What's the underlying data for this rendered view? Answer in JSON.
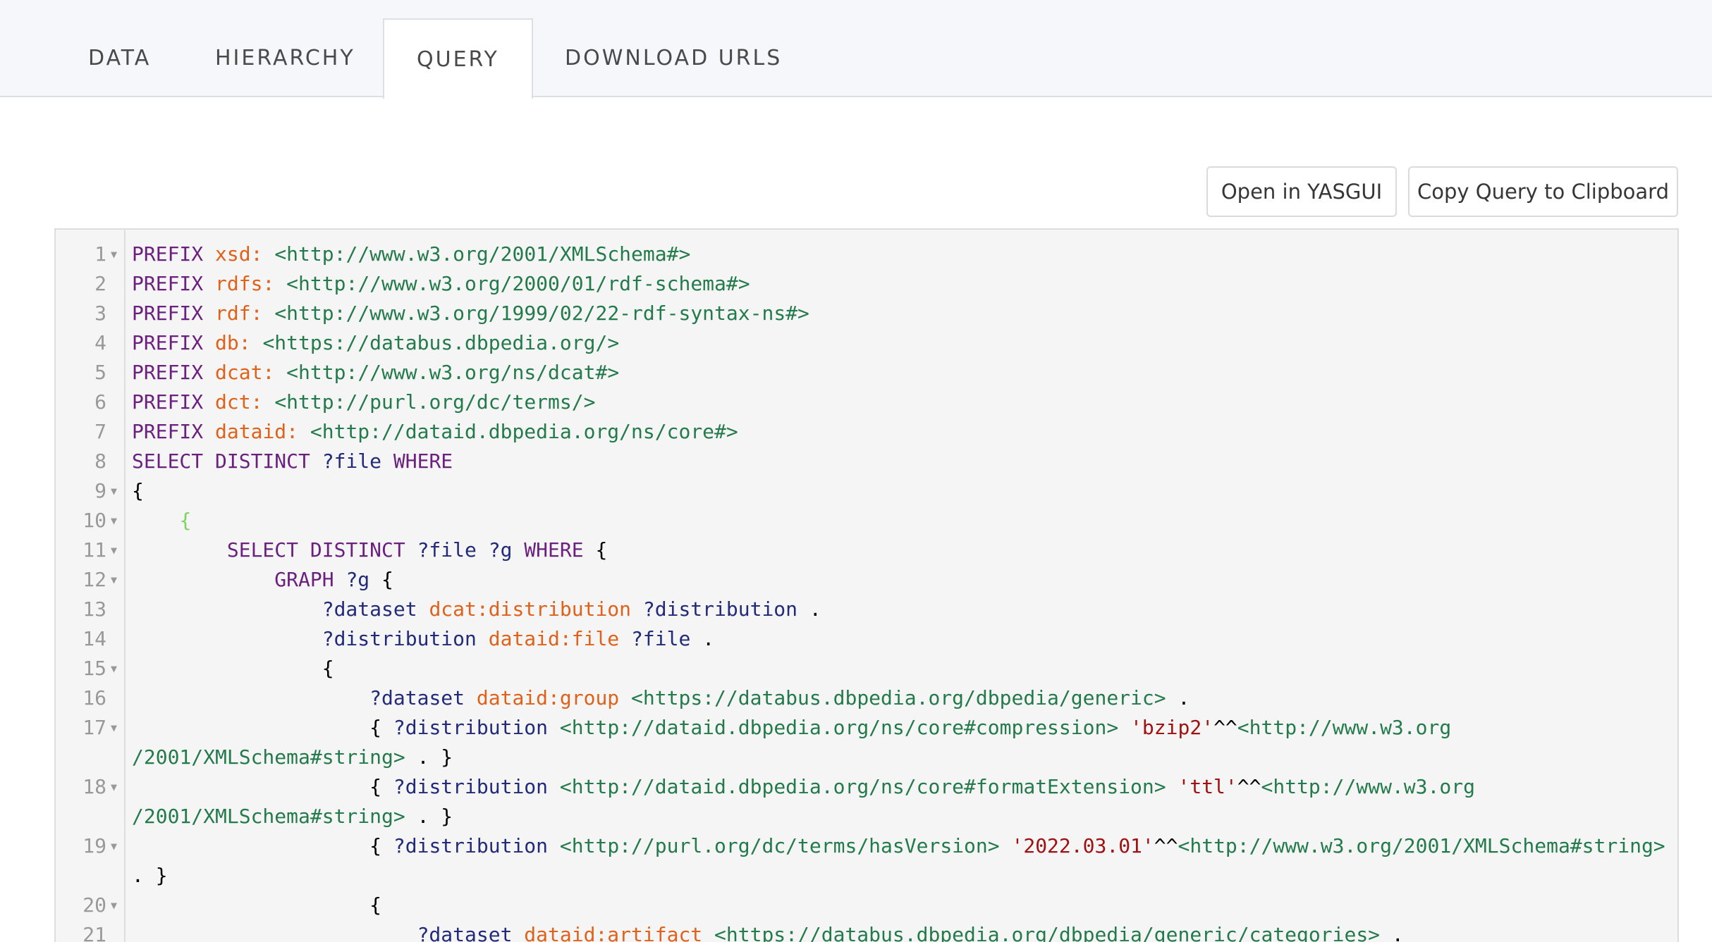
{
  "tabs": [
    {
      "label": "DATA",
      "active": false
    },
    {
      "label": "HIERARCHY",
      "active": false
    },
    {
      "label": "QUERY",
      "active": true
    },
    {
      "label": "DOWNLOAD URLS",
      "active": false
    }
  ],
  "toolbar": {
    "open_yasgui_label": "Open in YASGUI",
    "copy_query_label": "Copy Query to Clipboard"
  },
  "editor": {
    "lines": [
      {
        "num": "1",
        "fold": true,
        "tokens": [
          [
            "kw",
            "PREFIX "
          ],
          [
            "pfx",
            "xsd: "
          ],
          [
            "uri",
            "<http://www.w3.org/2001/XMLSchema#>"
          ]
        ]
      },
      {
        "num": "2",
        "fold": false,
        "tokens": [
          [
            "kw",
            "PREFIX "
          ],
          [
            "pfx",
            "rdfs: "
          ],
          [
            "uri",
            "<http://www.w3.org/2000/01/rdf-schema#>"
          ]
        ]
      },
      {
        "num": "3",
        "fold": false,
        "tokens": [
          [
            "kw",
            "PREFIX "
          ],
          [
            "pfx",
            "rdf: "
          ],
          [
            "uri",
            "<http://www.w3.org/1999/02/22-rdf-syntax-ns#>"
          ]
        ]
      },
      {
        "num": "4",
        "fold": false,
        "tokens": [
          [
            "kw",
            "PREFIX "
          ],
          [
            "pfx",
            "db: "
          ],
          [
            "uri",
            "<https://databus.dbpedia.org/>"
          ]
        ]
      },
      {
        "num": "5",
        "fold": false,
        "tokens": [
          [
            "kw",
            "PREFIX "
          ],
          [
            "pfx",
            "dcat: "
          ],
          [
            "uri",
            "<http://www.w3.org/ns/dcat#>"
          ]
        ]
      },
      {
        "num": "6",
        "fold": false,
        "tokens": [
          [
            "kw",
            "PREFIX "
          ],
          [
            "pfx",
            "dct: "
          ],
          [
            "uri",
            "<http://purl.org/dc/terms/>"
          ]
        ]
      },
      {
        "num": "7",
        "fold": false,
        "tokens": [
          [
            "kw",
            "PREFIX "
          ],
          [
            "pfx",
            "dataid: "
          ],
          [
            "uri",
            "<http://dataid.dbpedia.org/ns/core#>"
          ]
        ]
      },
      {
        "num": "8",
        "fold": false,
        "tokens": [
          [
            "kw",
            "SELECT DISTINCT "
          ],
          [
            "var",
            "?file "
          ],
          [
            "kw",
            "WHERE"
          ]
        ]
      },
      {
        "num": "9",
        "fold": true,
        "tokens": [
          [
            "txt",
            "{"
          ]
        ]
      },
      {
        "num": "10",
        "fold": true,
        "tokens": [
          [
            "txt",
            "    "
          ],
          [
            "brg",
            "{"
          ]
        ]
      },
      {
        "num": "11",
        "fold": true,
        "tokens": [
          [
            "txt",
            "        "
          ],
          [
            "kw",
            "SELECT DISTINCT "
          ],
          [
            "var",
            "?file ?g "
          ],
          [
            "kw",
            "WHERE "
          ],
          [
            "txt",
            "{"
          ]
        ]
      },
      {
        "num": "12",
        "fold": true,
        "tokens": [
          [
            "txt",
            "            "
          ],
          [
            "kw",
            "GRAPH "
          ],
          [
            "var",
            "?g "
          ],
          [
            "txt",
            "{"
          ]
        ]
      },
      {
        "num": "13",
        "fold": false,
        "tokens": [
          [
            "txt",
            "                "
          ],
          [
            "var",
            "?dataset "
          ],
          [
            "pfx",
            "dcat:distribution "
          ],
          [
            "var",
            "?distribution "
          ],
          [
            "txt",
            "."
          ]
        ]
      },
      {
        "num": "14",
        "fold": false,
        "tokens": [
          [
            "txt",
            "                "
          ],
          [
            "var",
            "?distribution "
          ],
          [
            "pfx",
            "dataid:file "
          ],
          [
            "var",
            "?file "
          ],
          [
            "txt",
            "."
          ]
        ]
      },
      {
        "num": "15",
        "fold": true,
        "tokens": [
          [
            "txt",
            "                {"
          ]
        ]
      },
      {
        "num": "16",
        "fold": false,
        "tokens": [
          [
            "txt",
            "                    "
          ],
          [
            "var",
            "?dataset "
          ],
          [
            "pfx",
            "dataid:group "
          ],
          [
            "uri",
            "<https://databus.dbpedia.org/dbpedia/generic> "
          ],
          [
            "txt",
            "."
          ]
        ]
      },
      {
        "num": "17",
        "fold": true,
        "tokens": [
          [
            "txt",
            "                    { "
          ],
          [
            "var",
            "?distribution "
          ],
          [
            "uri",
            "<http://dataid.dbpedia.org/ns/core#compression> "
          ],
          [
            "str",
            "'bzip2'"
          ],
          [
            "txt",
            "^^"
          ],
          [
            "uri",
            "<http://www.w3.org"
          ]
        ],
        "cont": [
          [
            "uri",
            "/2001/XMLSchema#string> "
          ],
          [
            "txt",
            ". }"
          ]
        ]
      },
      {
        "num": "18",
        "fold": true,
        "tokens": [
          [
            "txt",
            "                    { "
          ],
          [
            "var",
            "?distribution "
          ],
          [
            "uri",
            "<http://dataid.dbpedia.org/ns/core#formatExtension> "
          ],
          [
            "str",
            "'ttl'"
          ],
          [
            "txt",
            "^^"
          ],
          [
            "uri",
            "<http://www.w3.org"
          ]
        ],
        "cont": [
          [
            "uri",
            "/2001/XMLSchema#string> "
          ],
          [
            "txt",
            ". }"
          ]
        ]
      },
      {
        "num": "19",
        "fold": true,
        "tokens": [
          [
            "txt",
            "                    { "
          ],
          [
            "var",
            "?distribution "
          ],
          [
            "uri",
            "<http://purl.org/dc/terms/hasVersion> "
          ],
          [
            "str",
            "'2022.03.01'"
          ],
          [
            "txt",
            "^^"
          ],
          [
            "uri",
            "<http://www.w3.org/2001/XMLSchema#string>"
          ]
        ],
        "cont": [
          [
            "txt",
            ". }"
          ]
        ]
      },
      {
        "num": "20",
        "fold": true,
        "tokens": [
          [
            "txt",
            "                    {"
          ]
        ]
      },
      {
        "num": "21",
        "fold": false,
        "tokens": [
          [
            "txt",
            "                        "
          ],
          [
            "var",
            "?dataset "
          ],
          [
            "pfx",
            "dataid:artifact "
          ],
          [
            "uri",
            "<https://databus.dbpedia.org/dbpedia/generic/categories> "
          ],
          [
            "txt",
            "."
          ]
        ]
      }
    ]
  }
}
